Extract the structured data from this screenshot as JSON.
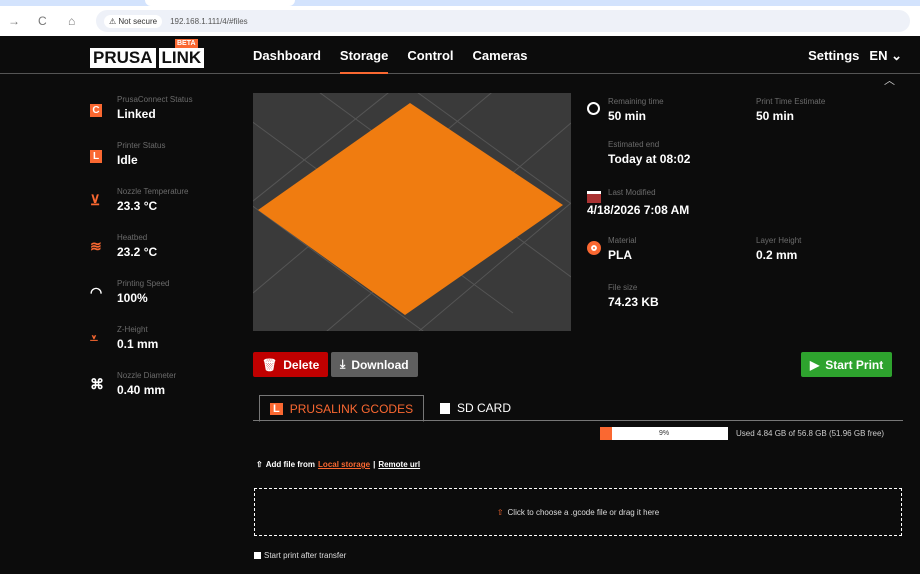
{
  "browser": {
    "security": "Not secure",
    "url": "192.168.1.111/4/#files"
  },
  "nav": {
    "logo_left": "PRUSA",
    "logo_right": "LINK",
    "beta": "BETA",
    "links": [
      "Dashboard",
      "Storage",
      "Control",
      "Cameras"
    ],
    "settings": "Settings",
    "lang": "EN"
  },
  "sidebar": [
    {
      "label": "PrusaConnect Status",
      "value": "Linked",
      "icon": "C"
    },
    {
      "label": "Printer Status",
      "value": "Idle",
      "icon": "L"
    },
    {
      "label": "Nozzle Temperature",
      "value": "23.3 °C"
    },
    {
      "label": "Heatbed",
      "value": "23.2 °C"
    },
    {
      "label": "Printing Speed",
      "value": "100%"
    },
    {
      "label": "Z-Height",
      "value": "0.1 mm"
    },
    {
      "label": "Nozzle Diameter",
      "value": "0.40 mm"
    }
  ],
  "info": {
    "remaining_label": "Remaining time",
    "remaining": "50 min",
    "estimate_label": "Print Time Estimate",
    "estimate": "50 min",
    "end_label": "Estimated end",
    "end": "Today at 08:02",
    "modified_label": "Last Modified",
    "modified": "4/18/2026 7:08 AM",
    "material_label": "Material",
    "material": "PLA",
    "layer_label": "Layer Height",
    "layer": "0.2 mm",
    "size_label": "File size",
    "size": "74.23 KB"
  },
  "actions": {
    "delete": "Delete",
    "download": "Download",
    "start": "Start Print"
  },
  "tabs": {
    "prusalink": "PRUSALINK GCODES",
    "sd": "SD CARD",
    "prusalink_icon": "L"
  },
  "storage": {
    "percent": "9%",
    "percent_value": 9,
    "used": "Used 4.84 GB of 56.8 GB (51.96 GB free)"
  },
  "upload": {
    "prefix": "Add file from",
    "local": "Local storage",
    "sep": "|",
    "remote": "Remote url",
    "drop": "Click to choose a .gcode file or drag it here",
    "start_after": "Start print after transfer"
  },
  "colors": {
    "accent": "#fa6831",
    "delete": "#c00000",
    "start": "#2ea32e"
  }
}
